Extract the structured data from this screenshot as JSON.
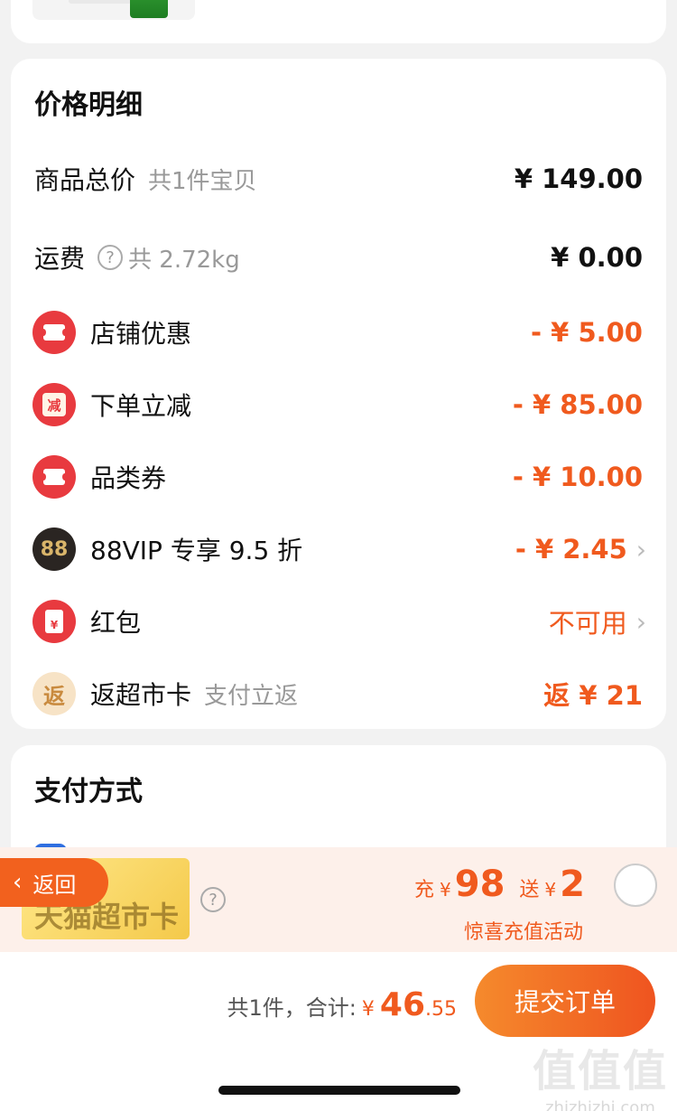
{
  "price_detail": {
    "title": "价格明细",
    "subtotal": {
      "label": "商品总价",
      "sub": "共1件宝贝",
      "value": "¥ 149.00"
    },
    "shipping": {
      "label": "运费",
      "sub": "共 2.72kg",
      "value": "¥ 0.00"
    },
    "discounts": [
      {
        "icon": "coupon-icon",
        "label": "店铺优惠",
        "value": "- ¥ 5.00"
      },
      {
        "icon": "instant-discount-icon",
        "label": "下单立减",
        "value": "- ¥ 85.00",
        "icon_text": "减"
      },
      {
        "icon": "coupon-icon",
        "label": "品类券",
        "value": "- ¥ 10.00"
      },
      {
        "icon": "vip88-icon",
        "label": "88VIP 专享 9.5 折",
        "value": "- ¥ 2.45",
        "icon_text": "88"
      },
      {
        "icon": "red-envelope-icon",
        "label": "红包",
        "value": "不可用",
        "icon_text": "¥"
      },
      {
        "icon": "cashback-icon",
        "label": "返超市卡",
        "sub": "支付立返",
        "value": "返 ¥ 21",
        "icon_text": "返"
      }
    ]
  },
  "payment": {
    "title": "支付方式",
    "promo": {
      "card_text": "天猫超市卡",
      "charge_word": "充",
      "charge_currency": "¥",
      "charge_amount": "98",
      "gift_word": "送",
      "gift_currency": "¥",
      "gift_amount": "2",
      "subtitle": "惊喜充值活动"
    }
  },
  "back_button": "返回",
  "footer": {
    "count_text": "共1件，合计:",
    "currency": "¥",
    "total_int": "46",
    "total_dec": ".55",
    "submit_label": "提交订单"
  },
  "watermark": {
    "logo": "值值值",
    "site": "zhizhizhi.com"
  },
  "colors": {
    "accent": "#f05a1e",
    "icon_red": "#e83a3f",
    "background": "#f2f2f2"
  }
}
